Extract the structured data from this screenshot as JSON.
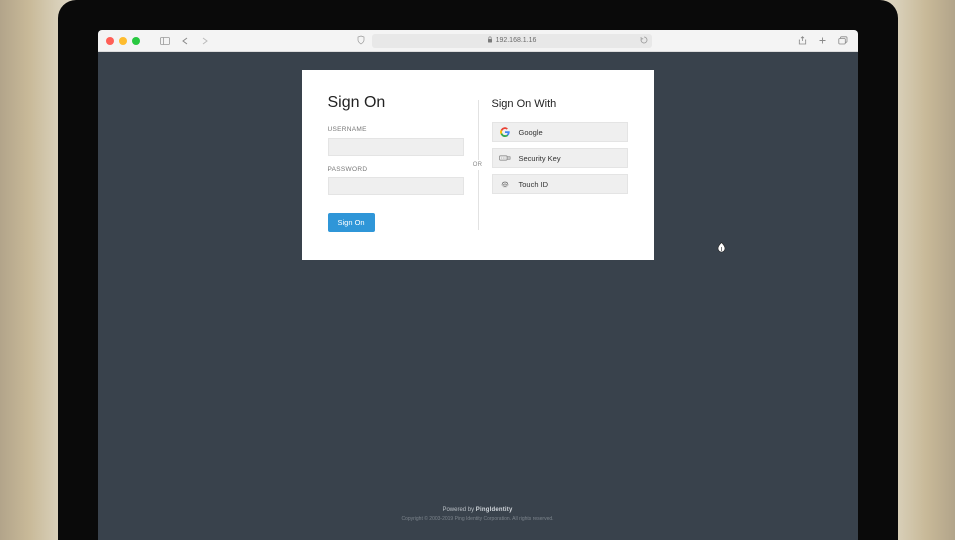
{
  "browser": {
    "address": "192.168.1.16"
  },
  "signon": {
    "title": "Sign On",
    "username_label": "USERNAME",
    "password_label": "PASSWORD",
    "submit_label": "Sign On"
  },
  "divider": {
    "or_label": "OR"
  },
  "sowith": {
    "title": "Sign On With",
    "providers": [
      {
        "label": "Google"
      },
      {
        "label": "Security Key"
      },
      {
        "label": "Touch ID"
      }
    ]
  },
  "footer": {
    "powered_prefix": "Powered by ",
    "powered_brand": "PingIdentity",
    "copyright": "Copyright © 2003-2019 Ping Identity Corporation. All rights reserved."
  }
}
